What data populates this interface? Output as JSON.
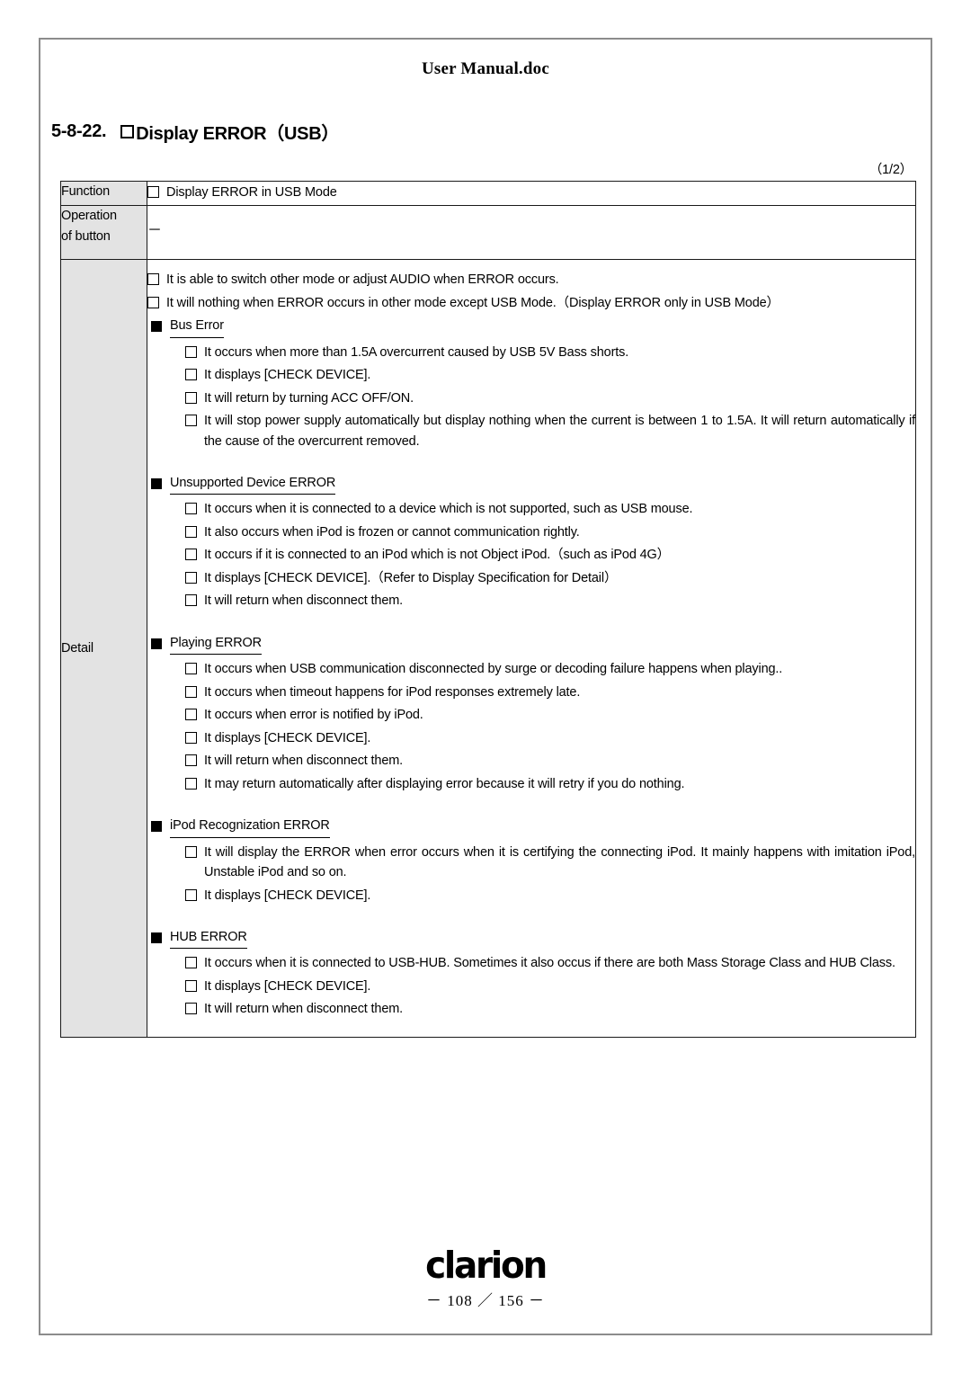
{
  "document": {
    "header_title": "User Manual.doc",
    "section_number": "5-8-22.",
    "section_title": "Display ERROR（USB）",
    "page_indicator": "（1/2）"
  },
  "table": {
    "rows": {
      "function": {
        "label": "Function",
        "item": "Display ERROR in USB Mode"
      },
      "operation": {
        "label_line1": "Operation",
        "label_line2": "of button",
        "value": "－"
      },
      "detail": {
        "label": "Detail",
        "intro_items": [
          "It is able to switch other mode or adjust AUDIO when ERROR occurs.",
          "It will nothing when ERROR occurs in other mode except USB Mode.（Display ERROR only in USB Mode）"
        ],
        "groups": [
          {
            "heading": "Bus Error",
            "items": [
              "It occurs when more than 1.5A overcurrent caused by USB 5V Bass shorts.",
              "It displays [CHECK DEVICE].",
              "It will return by turning ACC OFF/ON.",
              "It will stop power supply automatically but display nothing when the current is between 1 to 1.5A. It will return automatically if the cause of the overcurrent removed."
            ]
          },
          {
            "heading": "Unsupported Device ERROR",
            "items": [
              "It occurs when it is connected to a device which is not supported, such as USB mouse.",
              "It also occurs when iPod is frozen or cannot communication rightly.",
              "It occurs if it is connected to an iPod which is not Object iPod.（such as iPod 4G）",
              "It displays [CHECK DEVICE].（Refer to Display Specification for Detail）",
              "It will return when disconnect them."
            ]
          },
          {
            "heading": "Playing ERROR",
            "items": [
              "It occurs when USB communication disconnected by surge or decoding failure happens when playing..",
              "It occurs when timeout happens for iPod responses extremely late.",
              "It occurs when error is notified by iPod.",
              "It displays [CHECK DEVICE].",
              "It will return when disconnect them.",
              "It may return automatically after displaying error because it will retry if you do nothing."
            ]
          },
          {
            "heading": "iPod Recognization ERROR",
            "items": [
              "It will display the ERROR when error occurs when it is certifying the connecting iPod. It mainly happens with imitation iPod, Unstable iPod and so on.",
              "It displays [CHECK DEVICE]."
            ]
          },
          {
            "heading": "HUB ERROR",
            "items": [
              "It occurs when it is connected to USB-HUB. Sometimes it also occus if there are both Mass Storage Class and HUB Class.",
              "It displays [CHECK DEVICE].",
              "It will return when disconnect them."
            ]
          }
        ]
      }
    }
  },
  "footer": {
    "logo_text": "clarion",
    "page_number": "－ 108 ／ 156 －"
  }
}
